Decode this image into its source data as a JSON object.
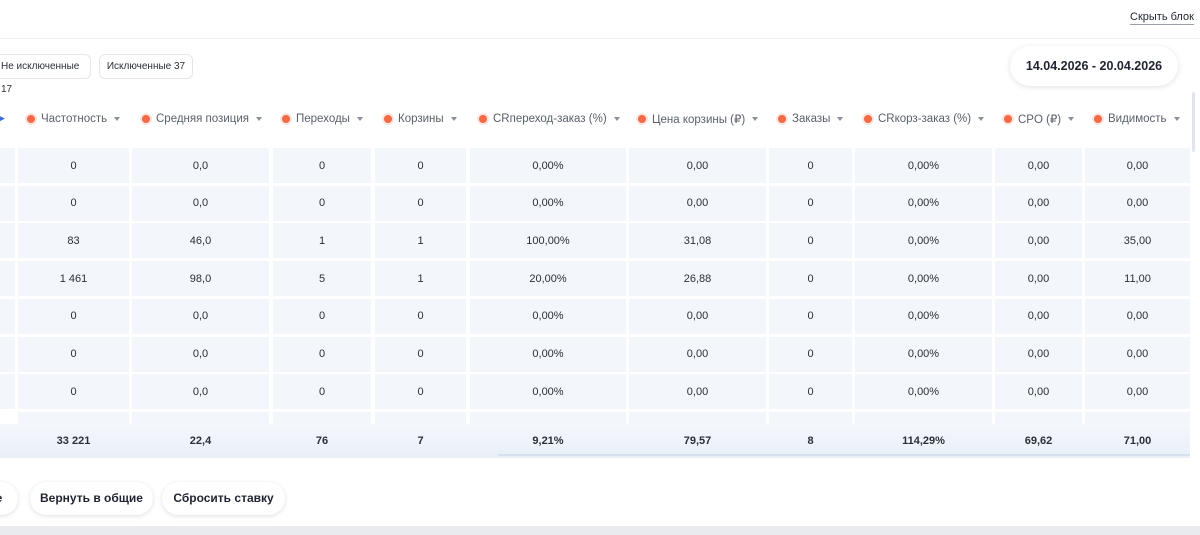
{
  "toolbar": {
    "hide_block_label": "Скрыть блок",
    "filter_not_excluded": "Не исключенные 17",
    "filter_excluded": "Исключенные 37",
    "date_range": "14.04.2026 - 20.04.2026"
  },
  "table": {
    "columns": [
      "Частотность",
      "Средняя позиция",
      "Переходы",
      "Корзины",
      "CRпереход-заказ (%)",
      "Цена корзины (₽)",
      "Заказы",
      "CRкорз-заказ (%)",
      "CPO (₽)",
      "Видимость"
    ],
    "rows": [
      [
        "0",
        "0,0",
        "0",
        "0",
        "0,00%",
        "0,00",
        "0",
        "0,00%",
        "0,00",
        "0,00"
      ],
      [
        "0",
        "0,0",
        "0",
        "0",
        "0,00%",
        "0,00",
        "0",
        "0,00%",
        "0,00",
        "0,00"
      ],
      [
        "83",
        "46,0",
        "1",
        "1",
        "100,00%",
        "31,08",
        "0",
        "0,00%",
        "0,00",
        "35,00"
      ],
      [
        "1 461",
        "98,0",
        "5",
        "1",
        "20,00%",
        "26,88",
        "0",
        "0,00%",
        "0,00",
        "11,00"
      ],
      [
        "0",
        "0,0",
        "0",
        "0",
        "0,00%",
        "0,00",
        "0",
        "0,00%",
        "0,00",
        "0,00"
      ],
      [
        "0",
        "0,0",
        "0",
        "0",
        "0,00%",
        "0,00",
        "0",
        "0,00%",
        "0,00",
        "0,00"
      ],
      [
        "0",
        "0,0",
        "0",
        "0",
        "0,00%",
        "0,00",
        "0",
        "0,00%",
        "0,00",
        "0,00"
      ]
    ],
    "totals": [
      "33 221",
      "22,4",
      "76",
      "7",
      "9,21%",
      "79,57",
      "8",
      "114,29%",
      "69,62",
      "71,00"
    ]
  },
  "actions": {
    "partial_left_label": "е",
    "return_label": "Вернуть в общие",
    "reset_bid_label": "Сбросить ставку"
  },
  "colors": {
    "accent_dot": "#f46a46",
    "cell_bg": "#f3f6fb"
  }
}
